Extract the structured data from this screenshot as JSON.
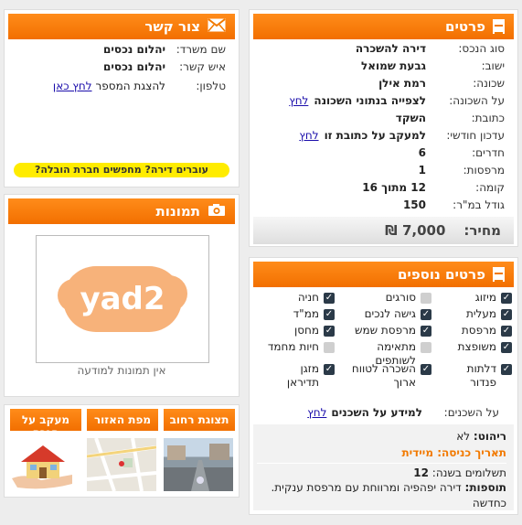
{
  "details": {
    "title": "פרטים",
    "rows": [
      {
        "label": "סוג הנכס:",
        "value": "דירה להשכרה"
      },
      {
        "label": "ישוב:",
        "value": "גבעת שמואל"
      },
      {
        "label": "שכונה:",
        "value": "רמת אילן"
      },
      {
        "label": "על השכונה:",
        "value": "לצפייה בנתוני השכונה",
        "link": "לחץ"
      },
      {
        "label": "כתובת:",
        "value": "השקד"
      },
      {
        "label": "עדכון חודשי:",
        "value": "למעקב על כתובת זו",
        "link": "לחץ"
      },
      {
        "label": "חדרים:",
        "value": "6"
      },
      {
        "label": "מרפסות:",
        "value": "1"
      },
      {
        "label": "קומה:",
        "value": "12 מתוך 16"
      },
      {
        "label": "גודל במ\"ר:",
        "value": "150"
      }
    ],
    "price_label": "מחיר:",
    "price_value": "7,000 ₪"
  },
  "contact": {
    "title": "צור קשר",
    "office_label": "שם משרד:",
    "office_value": "יהלום נכסים",
    "person_label": "איש קשר:",
    "person_value": "יהלום נכסים",
    "phone_label": "טלפון:",
    "phone_text": "להצגת המספר",
    "phone_link": "לחץ כאן",
    "banner": "עוברים דירה? מחפשים חברת הובלה?"
  },
  "photos": {
    "title": "תמונות",
    "logo_text": "yad2",
    "no_photos": "אין תמונות למודעה"
  },
  "tabs": {
    "street": "תצוגת רחוב",
    "area_map": "מפת האזור",
    "follow": "מעקב על הנכס"
  },
  "extras": {
    "title": "פרטים נוספים",
    "features": [
      {
        "label": "מיזוג",
        "checked": true
      },
      {
        "label": "סורגים",
        "checked": false
      },
      {
        "label": "חניה",
        "checked": true
      },
      {
        "label": "מעלית",
        "checked": true
      },
      {
        "label": "גישה לנכים",
        "checked": true
      },
      {
        "label": "ממ\"ד",
        "checked": true
      },
      {
        "label": "מרפסת",
        "checked": true
      },
      {
        "label": "מרפסת שמש",
        "checked": true
      },
      {
        "label": "מחסן",
        "checked": true
      },
      {
        "label": "משופצת",
        "checked": true
      },
      {
        "label": "מתאימה לשותפים",
        "checked": false
      },
      {
        "label": "חיות מחמד",
        "checked": false
      },
      {
        "label": "דלתות פנדור",
        "checked": true
      },
      {
        "label": "השכרה לטווח ארוך",
        "checked": true
      },
      {
        "label": "מזגן תדיראן",
        "checked": true
      }
    ],
    "neighbors_label": "על השכנים:",
    "neighbors_value": "למידע על השכנים",
    "neighbors_link": "לחץ",
    "furnished_label": "ריהוט:",
    "furnished_value": "לא",
    "entry_label": "תאריך כניסה:",
    "entry_value": "מיידית",
    "payments_label": "תשלומים בשנה:",
    "payments_value": "12",
    "additions_label": "תוספות:",
    "additions_value": "דירה יפהפיה ומרווחת עם מרפסת ענקית. כחדשה"
  },
  "colors": {
    "accent": "#f27a00",
    "link": "#1a0dab",
    "banner": "#ffec00"
  }
}
